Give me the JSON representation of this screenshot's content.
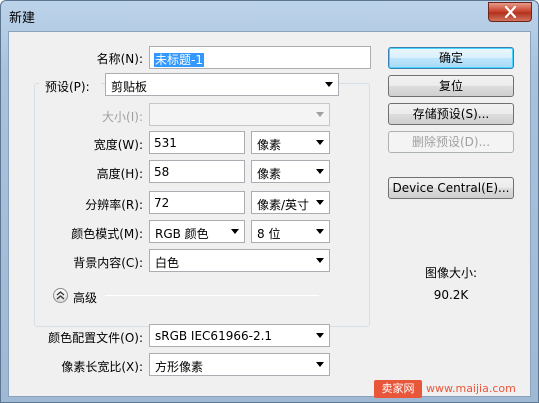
{
  "window": {
    "title": "新建"
  },
  "form": {
    "name_label": "名称(N):",
    "name_value": "未标题-1",
    "preset_label": "预设(P):",
    "preset_value": "剪贴板",
    "size_label": "大小(I):",
    "size_value": "",
    "width_label": "宽度(W):",
    "width_value": "531",
    "width_unit": "像素",
    "height_label": "高度(H):",
    "height_value": "58",
    "height_unit": "像素",
    "resolution_label": "分辨率(R):",
    "resolution_value": "72",
    "resolution_unit": "像素/英寸",
    "color_mode_label": "颜色模式(M):",
    "color_mode_value": "RGB 颜色",
    "bit_depth_value": "8 位",
    "background_label": "背景内容(C):",
    "background_value": "白色",
    "advanced_label": "高级",
    "color_profile_label": "颜色配置文件(O):",
    "color_profile_value": "sRGB IEC61966-2.1",
    "pixel_aspect_label": "像素长宽比(X):",
    "pixel_aspect_value": "方形像素"
  },
  "buttons": {
    "ok": "确定",
    "reset": "复位",
    "save_preset": "存储预设(S)...",
    "delete_preset": "删除预设(D)...",
    "device_central": "Device Central(E)..."
  },
  "info": {
    "image_size_label": "图像大小:",
    "image_size_value": "90.2K"
  },
  "watermark": {
    "logo_text": "卖家网",
    "url": "www.maijia.com"
  },
  "colors": {
    "title_bar": "#a9c2dc",
    "close_button": "#c9452f",
    "selection": "#3399ff",
    "dialog_bg": "#f0f0f0",
    "watermark": "#e9573b"
  }
}
